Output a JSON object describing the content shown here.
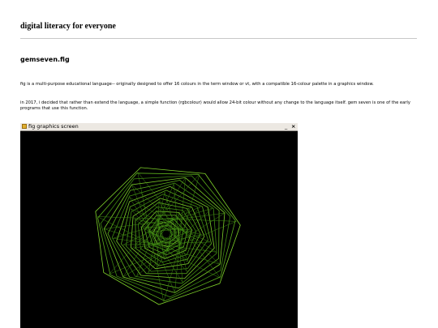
{
  "header": {
    "site_title": "digital literacy for everyone"
  },
  "post": {
    "title": "gemseven.fig",
    "paragraphs": [
      "fig is a multi-purpose educational language-- originally designed to offer 16 colours in the term window or vt, with a compatible 16-colour palette in a graphics window.",
      "in 2017, i decided that rather than extend the language, a simple function (rgbcolour) would allow 24-bit colour without any change to the language itself. gem seven is one of the early programs that use this function."
    ]
  },
  "graphics_window": {
    "title": "fig graphics screen",
    "minimize_label": "_",
    "close_label": "×",
    "background_color": "#000000",
    "line_colors": [
      "#7fd22a",
      "#5cae1c",
      "#3f8a12"
    ],
    "icon": "fig-app-icon"
  }
}
